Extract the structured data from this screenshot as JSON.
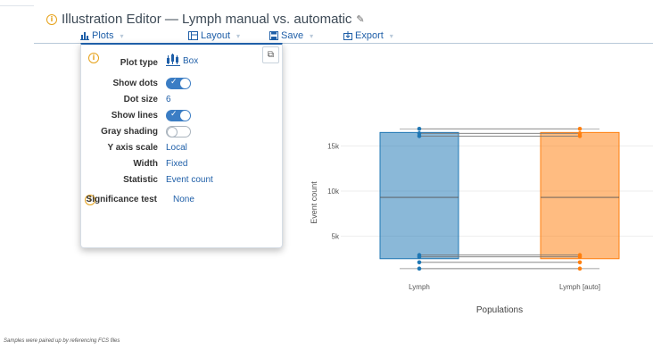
{
  "header": {
    "title": "Illustration Editor — Lymph manual vs. automatic",
    "menu": [
      {
        "label": "Plots",
        "icon": "bar-chart-icon"
      },
      {
        "label": "Layout",
        "icon": "layout-icon"
      },
      {
        "label": "Save",
        "icon": "save-icon"
      },
      {
        "label": "Export",
        "icon": "export-icon"
      }
    ]
  },
  "popover": {
    "plot_type_label": "Plot type",
    "plot_type_value": "Box",
    "show_dots_label": "Show dots",
    "show_dots": true,
    "dot_size_label": "Dot size",
    "dot_size_value": "6",
    "show_lines_label": "Show lines",
    "show_lines": true,
    "gray_shading_label": "Gray shading",
    "gray_shading": false,
    "y_axis_scale_label": "Y axis scale",
    "y_axis_scale_value": "Local",
    "width_label": "Width",
    "width_value": "Fixed",
    "statistic_label": "Statistic",
    "statistic_value": "Event count",
    "significance_label": "Significance test",
    "significance_value": "None"
  },
  "chart_data": {
    "type": "box",
    "categories": [
      "Lymph",
      "Lymph [auto]"
    ],
    "series": [
      {
        "category": "Lymph",
        "color": "#1f77b4",
        "q1": 2500,
        "median": 9300,
        "q3": 16500,
        "points": [
          16900,
          16400,
          16100,
          2900,
          2700,
          2100,
          1400
        ]
      },
      {
        "category": "Lymph [auto]",
        "color": "#ff7f0e",
        "q1": 2500,
        "median": 9300,
        "q3": 16500,
        "points": [
          16900,
          16400,
          16100,
          2900,
          2700,
          2100,
          1400
        ]
      }
    ],
    "ylabel": "Event count",
    "xlabel": "Populations",
    "ylim": [
      0,
      20000
    ],
    "yticks": [
      5000,
      10000,
      15000
    ],
    "ytick_labels": [
      "5k",
      "10k",
      "15k"
    ],
    "grid": true
  },
  "footnote": "Samples were paired up by referencing FCS files"
}
